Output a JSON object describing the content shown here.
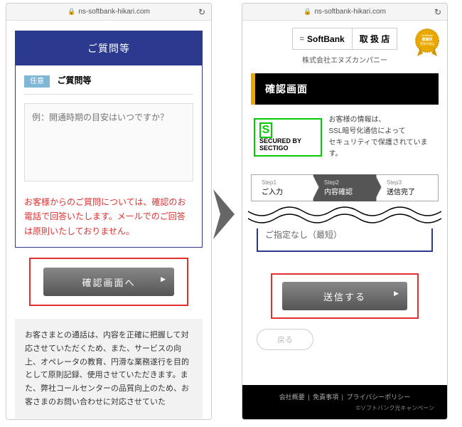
{
  "url": "ns-softbank-hikari.com",
  "left": {
    "form_title": "ご質問等",
    "badge": "任意",
    "badge_label": "ご質問等",
    "textarea_placeholder": "例：開通時期の目安はいつですか？",
    "red_note": "お客様からのご質問については、確認のお電話で回答いたします。メールでのご回答は原則いたしておりません。",
    "confirm_btn": "確認画面へ",
    "disclaimer": "お客さまとの通話は、内容を正確に把握して対応させていただくため、また、サービスの向上、オペレータの教育、円滑な業務遂行を目的として原則記録、使用させていただきます。また、弊社コールセンターの品質向上のため、お客さまのお問い合わせに対応させていた"
  },
  "right": {
    "brand": "SoftBank",
    "shop_label": "取 扱 店",
    "company": "株式会社エヌズカンパニー",
    "seal_lines": [
      "SoftBank",
      "感謝状",
      "受賞代理店"
    ],
    "confirm_title": "確認画面",
    "sectigo_top": "SECURED BY",
    "sectigo_name": "SECTIGO",
    "sectigo_note": "お客様の情報は、\nSSL暗号化通信によって\nセキュリティで保護されています。",
    "steps": [
      {
        "num": "Step1",
        "label": "ご入力"
      },
      {
        "num": "Step2",
        "label": "内容確認"
      },
      {
        "num": "Step3",
        "label": "送信完了"
      }
    ],
    "review_text": "ご指定なし（最短）",
    "submit_btn": "送信する",
    "back_btn": "戻る",
    "footer_links": [
      "会社概要",
      "免責事項",
      "プライバシーポリシー"
    ],
    "footer_copy": "©ソフトバンク光キャンペーン"
  }
}
